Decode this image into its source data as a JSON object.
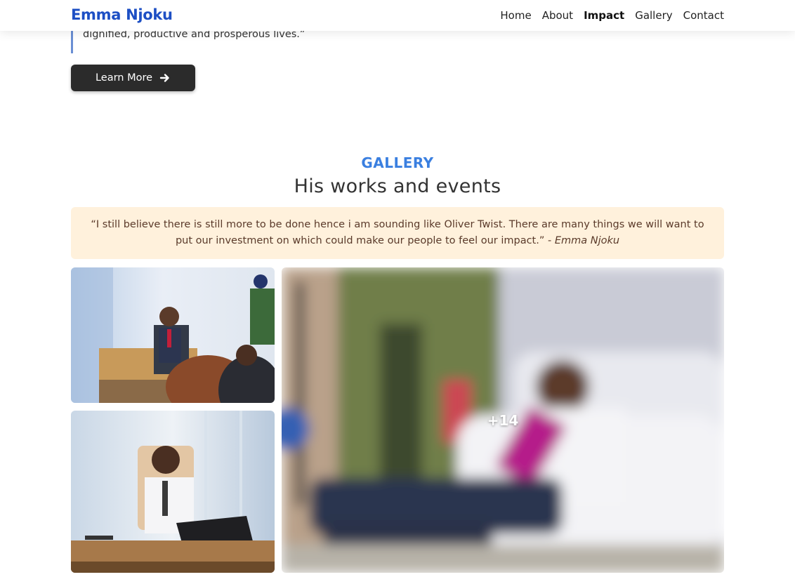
{
  "brand": "Emma Njoku",
  "nav": {
    "home": "Home",
    "about": "About",
    "impact": "Impact",
    "gallery": "Gallery",
    "contact": "Contact"
  },
  "intro": {
    "quote_tail": "dignified, productive and prosperous lives.”",
    "button_label": "Learn More"
  },
  "gallery": {
    "label": "GALLERY",
    "title": "His works and events",
    "quote_text": "“I still believe there is still more to be done hence i am sounding like Oliver Twist. There are many things we will want to put our investment on which could make our people to feel our impact.” - ",
    "quote_author": "Emma Njoku",
    "more_count": "+14"
  },
  "colors": {
    "brand": "#1d4fc4",
    "accent": "#3a7fe0",
    "quote_bg": "#fff1dc",
    "button_bg": "#2b2b2b"
  },
  "icons": {
    "button_icon": "arrow-right-icon"
  }
}
